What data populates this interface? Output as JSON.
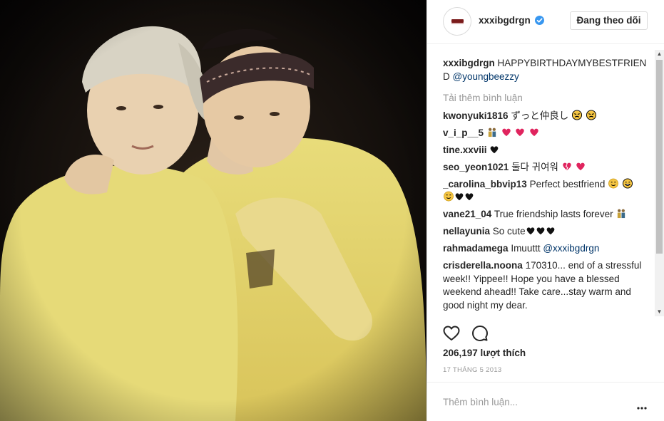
{
  "post": {
    "photo_alt": "childhood photo"
  },
  "header": {
    "username": "xxxibgdrgn",
    "follow_label": "Đang theo dõi"
  },
  "caption": {
    "username": "xxxibgdrgn",
    "text": "HAPPYBIRTHDAYMYBESTFRIEN D",
    "mention": "@youngbeezzy"
  },
  "load_more_label": "Tải thêm bình luận",
  "comments": [
    {
      "username": "kwonyuki1816",
      "text": "ずっと仲良し",
      "emojis": [
        "face-persevere",
        "face-persevere"
      ]
    },
    {
      "username": "v_i_p__5",
      "text": "",
      "emojis": [
        "couple",
        "heart",
        "heart",
        "heart"
      ]
    },
    {
      "username": "tine.xxviii",
      "text": "",
      "emojis": [
        "black-heart"
      ]
    },
    {
      "username": "seo_yeon1021",
      "text": "둘다 귀여워",
      "emojis": [
        "broken-heart",
        "heart"
      ]
    },
    {
      "username": "_carolina_bbvip13",
      "text": "Perfect bestfriend",
      "emojis": [
        "face-blush",
        "face-grin",
        "face-blush",
        "black-heart",
        "black-heart"
      ]
    },
    {
      "username": "vane21_04",
      "text": "True friendship lasts forever",
      "emojis": [
        "couple"
      ]
    },
    {
      "username": "nellayunia",
      "text": "So cute",
      "emojis": [
        "black-heart",
        "black-heart",
        "black-heart"
      ]
    },
    {
      "username": "rahmadamega",
      "text": "Imuuttt",
      "mention": "@xxxibgdrgn",
      "emojis": []
    },
    {
      "username": "crisderella.noona",
      "text": "170310... end of a stressful week!! Yippee!! Hope you have a blessed weekend ahead!! Take care...stay warm and good night my dear.",
      "emojis": []
    }
  ],
  "actions": {
    "like_icon": "heart-outline-icon",
    "comment_icon": "comment-bubble-icon"
  },
  "likes_label": "206,197 lượt thích",
  "date_label": "17 THÁNG 5 2013",
  "add_comment": {
    "placeholder": "Thêm bình luận...",
    "more_icon": "more-dots-icon"
  },
  "colors": {
    "verified": "#3897f0",
    "muted": "#999999",
    "mention": "#003569",
    "border": "#efefef"
  }
}
